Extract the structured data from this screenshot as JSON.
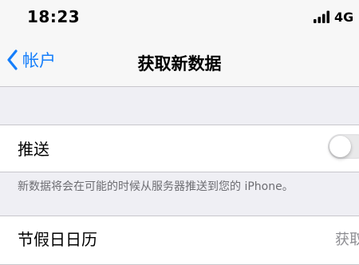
{
  "status_bar": {
    "time": "18:23",
    "network": "4G",
    "signal_icon": "cellular-signal-icon"
  },
  "nav": {
    "back_label": "帐户",
    "back_icon": "chevron-left-icon",
    "title": "获取新数据",
    "accent_color": "#157efb"
  },
  "push": {
    "label": "推送",
    "enabled": false,
    "footer": "新数据将会在可能的时候从服务器推送到您的 iPhone。"
  },
  "accounts": [
    {
      "label": "节假日日历",
      "value": "获取"
    }
  ]
}
